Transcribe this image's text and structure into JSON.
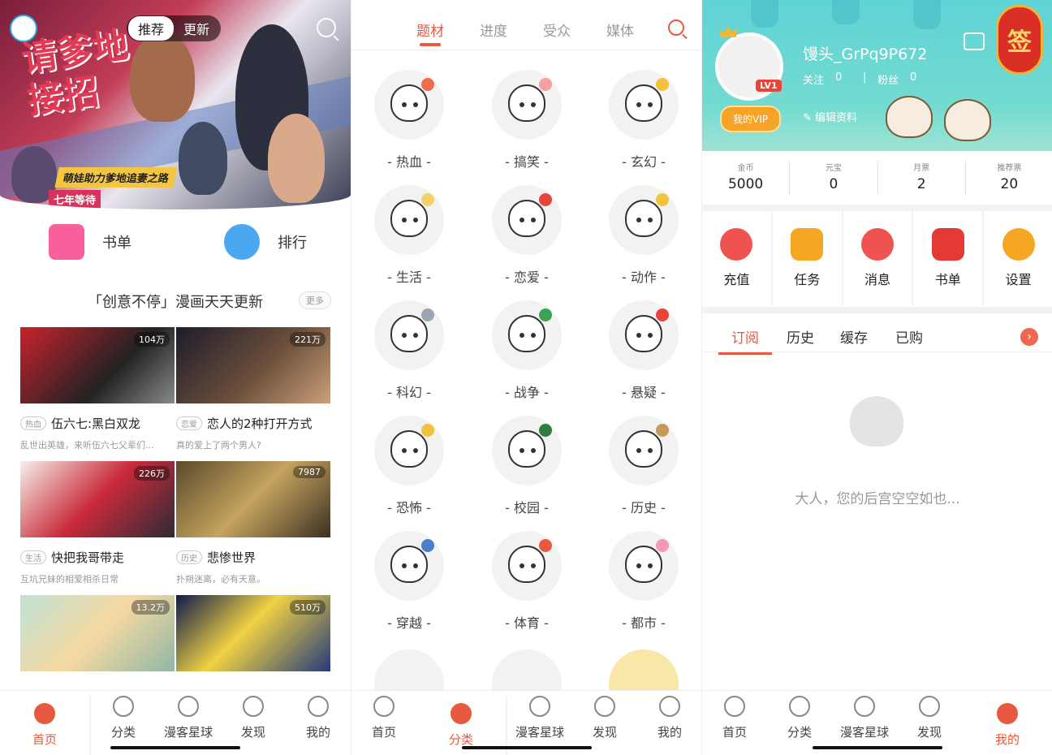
{
  "screen1": {
    "top_tabs": [
      "推荐",
      "更新"
    ],
    "banner": {
      "title": "请爹地接招",
      "tagline": "萌娃助力爹地追妻之路",
      "schedule": "七年等待"
    },
    "quick": [
      {
        "label": "书单",
        "icon": "booklist-icon"
      },
      {
        "label": "排行",
        "icon": "ranking-icon"
      }
    ],
    "section_title": "「创意不停」漫画天天更新",
    "more_label": "更多",
    "comics": [
      {
        "views": "104万",
        "genre": "热血",
        "title": "伍六七:黑白双龙",
        "desc": "乱世出英雄，来听伍六七父辈们..."
      },
      {
        "views": "221万",
        "genre": "恋爱",
        "title": "恋人的2种打开方式",
        "desc": "真的爱上了两个男人?"
      },
      {
        "views": "226万",
        "genre": "生活",
        "title": "快把我哥带走",
        "desc": "互坑兄妹的相爱相杀日常"
      },
      {
        "views": "7987",
        "genre": "历史",
        "title": "悲惨世界",
        "desc": "扑朔迷离，必有天意。"
      },
      {
        "views": "13.2万",
        "genre": "",
        "title": "",
        "desc": ""
      },
      {
        "views": "510万",
        "genre": "",
        "title": "",
        "desc": ""
      }
    ]
  },
  "screen2": {
    "tabs": [
      "题材",
      "进度",
      "受众",
      "媒体"
    ],
    "genres": [
      "热血",
      "搞笑",
      "玄幻",
      "生活",
      "恋爱",
      "动作",
      "科幻",
      "战争",
      "悬疑",
      "恐怖",
      "校园",
      "历史",
      "穿越",
      "体育",
      "都市"
    ],
    "genre_label_format": "- {x} -"
  },
  "screen3": {
    "username": "馒头_GrPq9P672",
    "follow_label": "关注",
    "follow_count": "0",
    "fans_label": "粉丝",
    "fans_count": "0",
    "level": "LV1",
    "vip_label": "我的VIP",
    "edit_label": "编辑资料",
    "sign_label": "签",
    "stats": [
      {
        "label": "金币",
        "value": "5000"
      },
      {
        "label": "元宝",
        "value": "0"
      },
      {
        "label": "月票",
        "value": "2"
      },
      {
        "label": "推荐票",
        "value": "20"
      }
    ],
    "actions": [
      {
        "label": "充值",
        "color": "#ef5350"
      },
      {
        "label": "任务",
        "color": "#f5a623"
      },
      {
        "label": "消息",
        "color": "#ef5350"
      },
      {
        "label": "书单",
        "color": "#e53935"
      },
      {
        "label": "设置",
        "color": "#f5a623"
      }
    ],
    "tabs": [
      "订阅",
      "历史",
      "缓存",
      "已购"
    ],
    "empty_text": "大人，您的后宫空空如也..."
  },
  "nav": [
    "首页",
    "分类",
    "漫客星球",
    "发现",
    "我的"
  ],
  "colors": {
    "accent": "#e85a40"
  }
}
